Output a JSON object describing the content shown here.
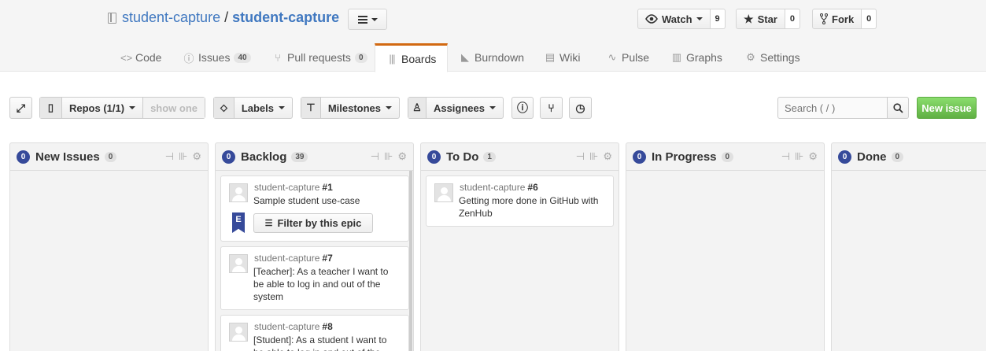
{
  "repo": {
    "owner": "student-capture",
    "separator": "/",
    "name": "student-capture"
  },
  "social": {
    "watch": {
      "label": "Watch",
      "count": "9"
    },
    "star": {
      "label": "Star",
      "count": "0"
    },
    "fork": {
      "label": "Fork",
      "count": "0"
    }
  },
  "tabs": [
    {
      "label": "Code",
      "icon": "code-icon"
    },
    {
      "label": "Issues",
      "counter": "40",
      "icon": "issue-icon"
    },
    {
      "label": "Pull requests",
      "counter": "0",
      "icon": "pull-request-icon"
    },
    {
      "label": "Boards",
      "icon": "boards-icon",
      "active": true
    },
    {
      "label": "Burndown",
      "icon": "burndown-icon"
    },
    {
      "label": "Wiki",
      "icon": "wiki-icon"
    },
    {
      "label": "Pulse",
      "icon": "pulse-icon"
    },
    {
      "label": "Graphs",
      "icon": "graphs-icon"
    },
    {
      "label": "Settings",
      "icon": "gear-icon"
    }
  ],
  "toolbar": {
    "repos_label": "Repos (1/1)",
    "show_one_label": "show one",
    "labels_label": "Labels",
    "milestones_label": "Milestones",
    "assignees_label": "Assignees",
    "search_placeholder": "Search ( / )",
    "new_issue_label": "New issue"
  },
  "pipelines": [
    {
      "name": "New Issues",
      "count": "0",
      "badge": "0",
      "cards": []
    },
    {
      "name": "Backlog",
      "count": "0",
      "badge": "39",
      "cards": [
        {
          "repo": "student-capture",
          "number": "#1",
          "title": "Sample student use-case",
          "epic": "E",
          "filter_label": "Filter by this epic"
        },
        {
          "repo": "student-capture",
          "number": "#7",
          "title": "[Teacher]: As a teacher I want to be able to log in and out of the system"
        },
        {
          "repo": "student-capture",
          "number": "#8",
          "title": "[Student]: As a student I want to be able to log in and out of the"
        }
      ]
    },
    {
      "name": "To Do",
      "count": "0",
      "badge": "1",
      "cards": [
        {
          "repo": "student-capture",
          "number": "#6",
          "title": "Getting more done in GitHub with ZenHub"
        }
      ]
    },
    {
      "name": "In Progress",
      "count": "0",
      "badge": "0",
      "cards": []
    },
    {
      "name": "Done",
      "count": "0",
      "badge": "0",
      "cards": []
    }
  ],
  "colors": {
    "accent": "#364a9a",
    "link": "#4078c0",
    "tab_active": "#d26911",
    "new_issue": "#6cc644"
  }
}
